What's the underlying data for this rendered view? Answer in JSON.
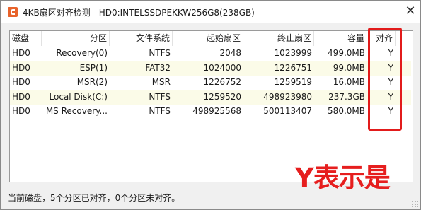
{
  "window": {
    "title": "4KB扇区对齐检测 - HD0:INTELSSDPEKKW256G8(238GB)",
    "close_glyph": "✕"
  },
  "table": {
    "headers": [
      "磁盘",
      "分区",
      "文件系统",
      "起始扇区",
      "终止扇区",
      "容量",
      "对齐"
    ],
    "rows": [
      [
        "HD0",
        "Recovery(0)",
        "NTFS",
        "2048",
        "1023999",
        "499.0MB",
        "Y"
      ],
      [
        "HD0",
        "ESP(1)",
        "FAT32",
        "1024000",
        "1226751",
        "99.0MB",
        "Y"
      ],
      [
        "HD0",
        "MSR(2)",
        "MSR",
        "1226752",
        "1259519",
        "16.0MB",
        "Y"
      ],
      [
        "HD0",
        "Local Disk(C:)",
        "NTFS",
        "1259520",
        "498923980",
        "237.3GB",
        "Y"
      ],
      [
        "HD0",
        "MS Recovery...",
        "NTFS",
        "498925568",
        "500113407",
        "580.0MB",
        "Y"
      ]
    ]
  },
  "annotation": {
    "text": "Y表示是",
    "color": "#e61e1e"
  },
  "status": {
    "text": "当前磁盘，5个分区已对齐，0个分区未对齐。"
  },
  "colors": {
    "highlight_box": "#e21b1b",
    "alt_row": "#fbfbe8",
    "app_icon": "#e8632b"
  }
}
